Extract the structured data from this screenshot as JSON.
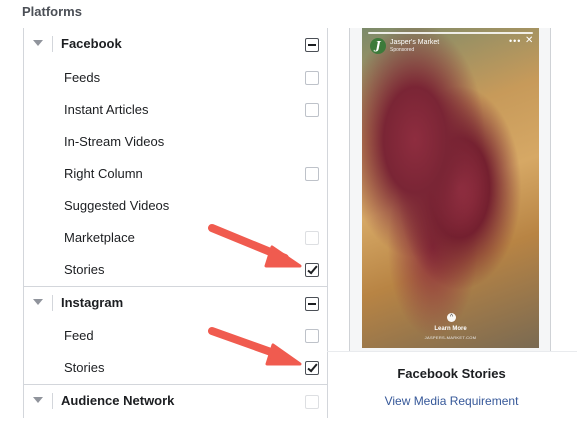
{
  "section": {
    "title": "Platforms"
  },
  "groups": [
    {
      "label": "Facebook",
      "state": "partial",
      "items": [
        {
          "label": "Feeds",
          "checked": false,
          "checkbox": true
        },
        {
          "label": "Instant Articles",
          "checked": false,
          "checkbox": true
        },
        {
          "label": "In-Stream Videos",
          "checked": false,
          "checkbox": false
        },
        {
          "label": "Right Column",
          "checked": false,
          "checkbox": true
        },
        {
          "label": "Suggested Videos",
          "checked": false,
          "checkbox": false
        },
        {
          "label": "Marketplace",
          "checked": false,
          "checkbox": true
        },
        {
          "label": "Stories",
          "checked": true,
          "checkbox": true
        }
      ]
    },
    {
      "label": "Instagram",
      "state": "partial",
      "items": [
        {
          "label": "Feed",
          "checked": false,
          "checkbox": true
        },
        {
          "label": "Stories",
          "checked": true,
          "checkbox": true
        }
      ]
    },
    {
      "label": "Audience Network",
      "state": "unchecked",
      "items": []
    }
  ],
  "preview": {
    "brand_initial": "J",
    "brand_name": "Jasper's Market",
    "sponsored": "Sponsored",
    "more": "•••",
    "close": "✕",
    "swipe_icon": "^",
    "cta": "Learn More",
    "cta_url": "JASPERS-MARKET.COM",
    "title": "Facebook Stories",
    "link": "View Media Requirement"
  },
  "colors": {
    "link": "#365899",
    "annotation_arrow": "#f05b4f",
    "border": "#d3d6db"
  }
}
